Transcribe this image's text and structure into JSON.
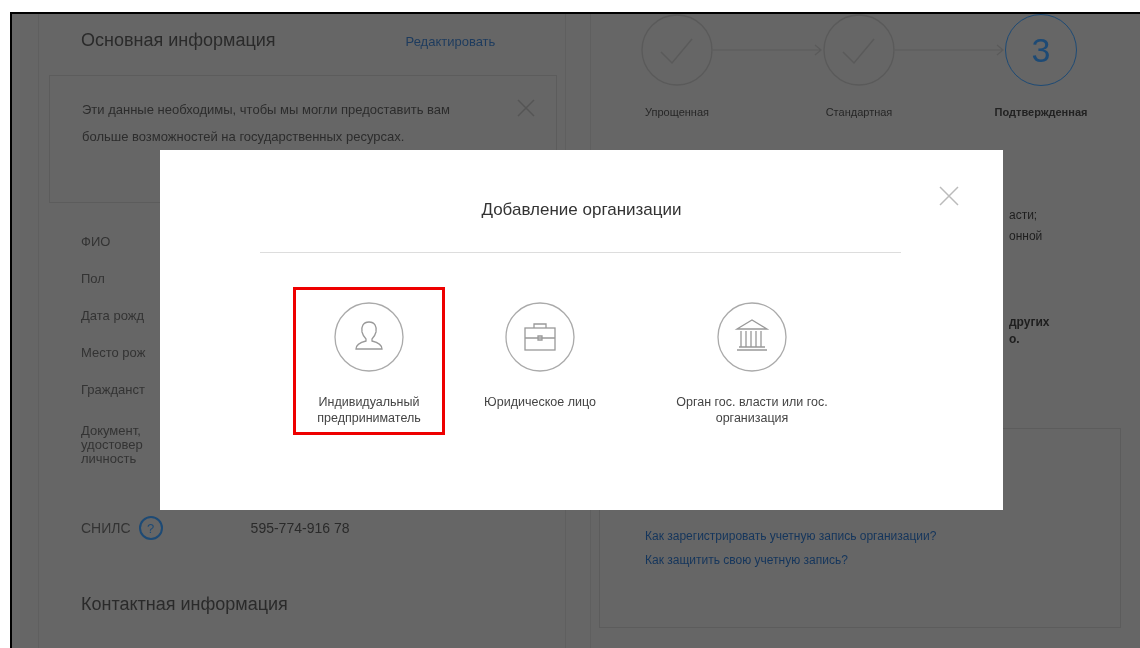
{
  "profile": {
    "title": "Основная информация",
    "edit_link": "Редактировать",
    "notice": "Эти данные необходимы, чтобы мы могли предоставить вам больше возможностей на государственных ресурсах.",
    "fields": [
      {
        "label": "ФИО"
      },
      {
        "label": "Пол"
      },
      {
        "label": "Дата рожд"
      },
      {
        "label": "Место рож"
      },
      {
        "label": "Гражданст"
      },
      {
        "label": "Документ, удостовер личность"
      }
    ],
    "snils": {
      "label": "СНИЛС",
      "help": "?",
      "value": "595-774-916 78"
    },
    "contacts_title": "Контактная информация"
  },
  "account_levels": {
    "steps": [
      {
        "label": "Упрощенная",
        "kind": "done"
      },
      {
        "label": "Стандартная",
        "kind": "done"
      },
      {
        "label": "Подтвержденная",
        "kind": "current",
        "number": "3"
      }
    ],
    "text_fragments": [
      "асти;",
      "онной"
    ],
    "bold_fragments": [
      "других",
      "о."
    ]
  },
  "help_links": [
    "Как зарегистрировать учетную запись организации?",
    "Как защитить свою учетную запись?"
  ],
  "dialog": {
    "title": "Добавление организации",
    "options": [
      {
        "label": "Индивидуальный предприниматель",
        "selected": true
      },
      {
        "label": "Юридическое лицо",
        "selected": false
      },
      {
        "label": "Орган гос. власти или гос. организация",
        "selected": false
      }
    ]
  }
}
